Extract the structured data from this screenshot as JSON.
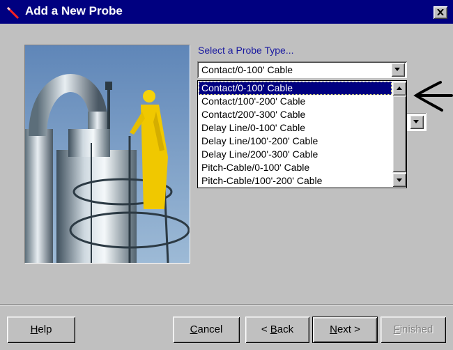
{
  "window": {
    "title": "Add a New Probe",
    "close_glyph": "✕",
    "icon": "probe-icon"
  },
  "prompt": {
    "label": "Select a Probe Type..."
  },
  "probe_type_select": {
    "value": "Contact/0-100' Cable",
    "options": [
      "Contact/0-100' Cable",
      "Contact/100'-200' Cable",
      "Contact/200'-300' Cable",
      "Delay Line/0-100' Cable",
      "Delay Line/100'-200' Cable",
      "Delay Line/200'-300' Cable",
      "Pitch-Cable/0-100' Cable",
      "Pitch-Cable/100'-200' Cable"
    ],
    "selected_index": 0,
    "scroll_fraction": 0.0
  },
  "buttons": {
    "help": {
      "mnemonic": "H",
      "rest": "elp"
    },
    "cancel": {
      "mnemonic": "C",
      "rest": "ancel"
    },
    "back": {
      "prefix": "< ",
      "mnemonic": "B",
      "rest": "ack"
    },
    "next": {
      "mnemonic": "N",
      "rest": "ext >"
    },
    "finished": {
      "mnemonic": "F",
      "rest": "inished",
      "enabled": false
    }
  },
  "colors": {
    "title_bar": "#000080",
    "selection": "#000080",
    "face": "#c0c0c0",
    "label_text": "#1a1aa0"
  }
}
